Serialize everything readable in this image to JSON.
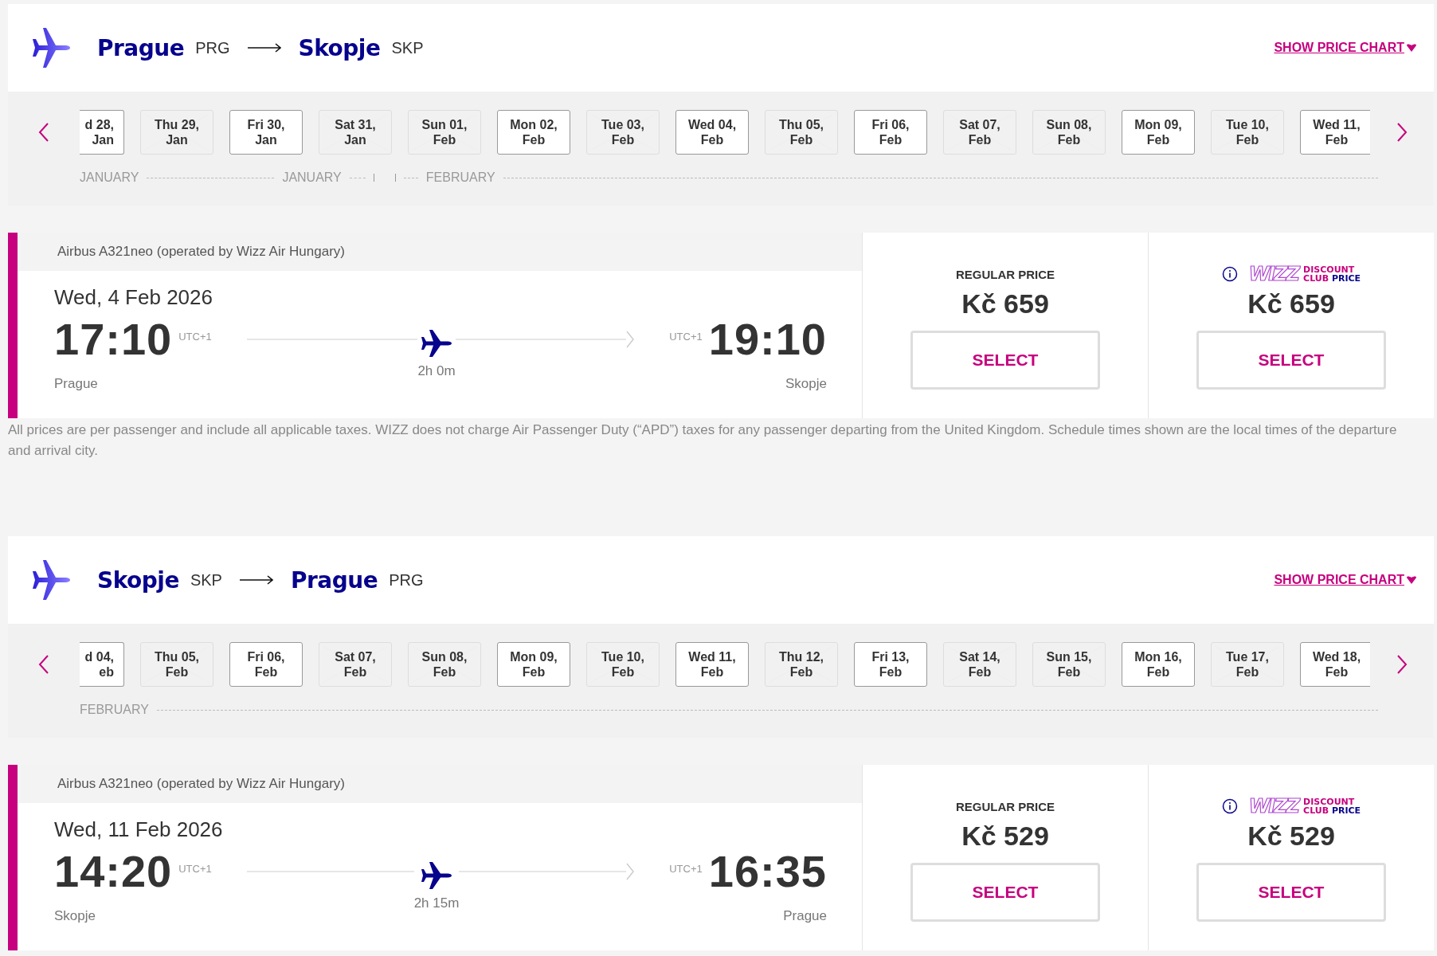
{
  "outbound": {
    "origin": {
      "city": "Prague",
      "code": "PRG"
    },
    "destination": {
      "city": "Skopje",
      "code": "SKP"
    },
    "price_chart_link": "SHOW PRICE CHART",
    "dates": [
      {
        "day": "d 28,",
        "month": "Jan",
        "available": true
      },
      {
        "day": "Thu 29,",
        "month": "Jan",
        "available": false
      },
      {
        "day": "Fri 30,",
        "month": "Jan",
        "available": true
      },
      {
        "day": "Sat 31,",
        "month": "Jan",
        "available": false
      },
      {
        "day": "Sun 01,",
        "month": "Feb",
        "available": false
      },
      {
        "day": "Mon 02,",
        "month": "Feb",
        "available": true
      },
      {
        "day": "Tue 03,",
        "month": "Feb",
        "available": false
      },
      {
        "day": "Wed 04,",
        "month": "Feb",
        "available": true
      },
      {
        "day": "Thu 05,",
        "month": "Feb",
        "available": false
      },
      {
        "day": "Fri 06,",
        "month": "Feb",
        "available": true
      },
      {
        "day": "Sat 07,",
        "month": "Feb",
        "available": false
      },
      {
        "day": "Sun 08,",
        "month": "Feb",
        "available": false
      },
      {
        "day": "Mon 09,",
        "month": "Feb",
        "available": true
      },
      {
        "day": "Tue 10,",
        "month": "Feb",
        "available": false
      },
      {
        "day": "Wed 11,",
        "month": "Feb",
        "available": true
      }
    ],
    "months": [
      {
        "label": "JANUARY"
      },
      {
        "label": "JANUARY"
      },
      {
        "label": "FEBRUARY"
      }
    ],
    "flight": {
      "aircraft": "Airbus A321neo (operated by Wizz Air Hungary)",
      "date": "Wed, 4 Feb 2026",
      "departure": {
        "time": "17:10",
        "timezone": "UTC+1",
        "city": "Prague"
      },
      "arrival": {
        "time": "19:10",
        "timezone": "UTC+1",
        "city": "Skopje"
      },
      "duration": "2h 0m",
      "fares": [
        {
          "kind": "regular",
          "label": "REGULAR PRICE",
          "price": "Kč 659",
          "button": "SELECT"
        },
        {
          "kind": "club",
          "logo": {
            "brand": "WIZZ",
            "line1": "DISCOUNT",
            "line2a": "CLUB",
            "line2b": "PRICE"
          },
          "price": "Kč 659",
          "button": "SELECT"
        }
      ]
    }
  },
  "disclaimer": "All prices are per passenger and include all applicable taxes. WIZZ does not charge Air Passenger Duty (“APD”) taxes for any passenger departing from the United Kingdom. Schedule times shown are the local times of the departure and arrival city.",
  "return": {
    "origin": {
      "city": "Skopje",
      "code": "SKP"
    },
    "destination": {
      "city": "Prague",
      "code": "PRG"
    },
    "price_chart_link": "SHOW PRICE CHART",
    "dates": [
      {
        "day": "d 04,",
        "month": "eb",
        "available": true
      },
      {
        "day": "Thu 05,",
        "month": "Feb",
        "available": false
      },
      {
        "day": "Fri 06,",
        "month": "Feb",
        "available": true
      },
      {
        "day": "Sat 07,",
        "month": "Feb",
        "available": false
      },
      {
        "day": "Sun 08,",
        "month": "Feb",
        "available": false
      },
      {
        "day": "Mon 09,",
        "month": "Feb",
        "available": true
      },
      {
        "day": "Tue 10,",
        "month": "Feb",
        "available": false
      },
      {
        "day": "Wed 11,",
        "month": "Feb",
        "available": true
      },
      {
        "day": "Thu 12,",
        "month": "Feb",
        "available": false
      },
      {
        "day": "Fri 13,",
        "month": "Feb",
        "available": true
      },
      {
        "day": "Sat 14,",
        "month": "Feb",
        "available": false
      },
      {
        "day": "Sun 15,",
        "month": "Feb",
        "available": false
      },
      {
        "day": "Mon 16,",
        "month": "Feb",
        "available": true
      },
      {
        "day": "Tue 17,",
        "month": "Feb",
        "available": false
      },
      {
        "day": "Wed 18,",
        "month": "Feb",
        "available": true
      }
    ],
    "months": [
      {
        "label": "FEBRUARY"
      }
    ],
    "flight": {
      "aircraft": "Airbus A321neo (operated by Wizz Air Hungary)",
      "date": "Wed, 11 Feb 2026",
      "departure": {
        "time": "14:20",
        "timezone": "UTC+1",
        "city": "Skopje"
      },
      "arrival": {
        "time": "16:35",
        "timezone": "UTC+1",
        "city": "Prague"
      },
      "duration": "2h 15m",
      "fares": [
        {
          "kind": "regular",
          "label": "REGULAR PRICE",
          "price": "Kč 529",
          "button": "SELECT"
        },
        {
          "kind": "club",
          "logo": {
            "brand": "WIZZ",
            "line1": "DISCOUNT",
            "line2a": "CLUB",
            "line2b": "PRICE"
          },
          "price": "Kč 529",
          "button": "SELECT"
        }
      ]
    }
  }
}
